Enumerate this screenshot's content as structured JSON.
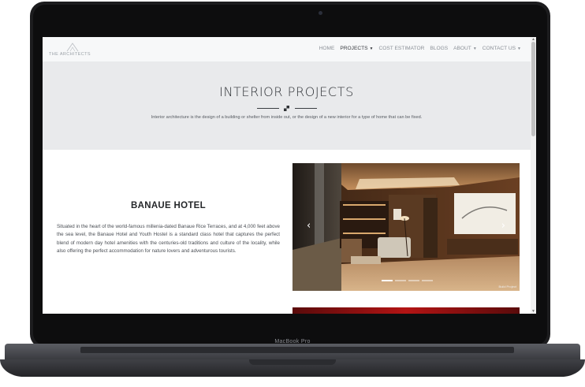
{
  "device": {
    "label": "MacBook Pro"
  },
  "nav": {
    "logo_text": "THE ARCHITECTS",
    "items": [
      {
        "label": "HOME",
        "dropdown": false,
        "active": false
      },
      {
        "label": "PROJECTS",
        "dropdown": true,
        "active": true
      },
      {
        "label": "COST ESTIMATOR",
        "dropdown": false,
        "active": false
      },
      {
        "label": "BLOGS",
        "dropdown": false,
        "active": false
      },
      {
        "label": "ABOUT",
        "dropdown": true,
        "active": false
      },
      {
        "label": "CONTACT US",
        "dropdown": true,
        "active": false
      }
    ]
  },
  "hero": {
    "title": "INTERIOR PROJECTS",
    "subtitle": "Interior architecture is the design of a building or shelter from inside out, or the design of a new interior for a type of home that can be fixed."
  },
  "project": {
    "title": "BANAUE HOTEL",
    "description": "Situated in the heart of the world-famous millenia-dated Banaue Rice Terraces, and at 4,000 feet above the sea level, the Banaue Hotel and Youth Hostel is a standard class hotel that captures the perfect blend of modern day hotel amenities with the centuries-old traditions and culture of the locality, while also offering the perfect accommodation for nature lovers and adventurous tourists."
  },
  "carousel": {
    "prev_icon": "chevron-left-icon",
    "next_icon": "chevron-right-icon",
    "slide_count": 4,
    "active_index": 0,
    "caption": "Build Project"
  },
  "colors": {
    "nav_bg": "#f7f8f9",
    "hero_bg": "#e9eaec",
    "text_dark": "#25272a",
    "next_slide_red": "#b31414"
  }
}
